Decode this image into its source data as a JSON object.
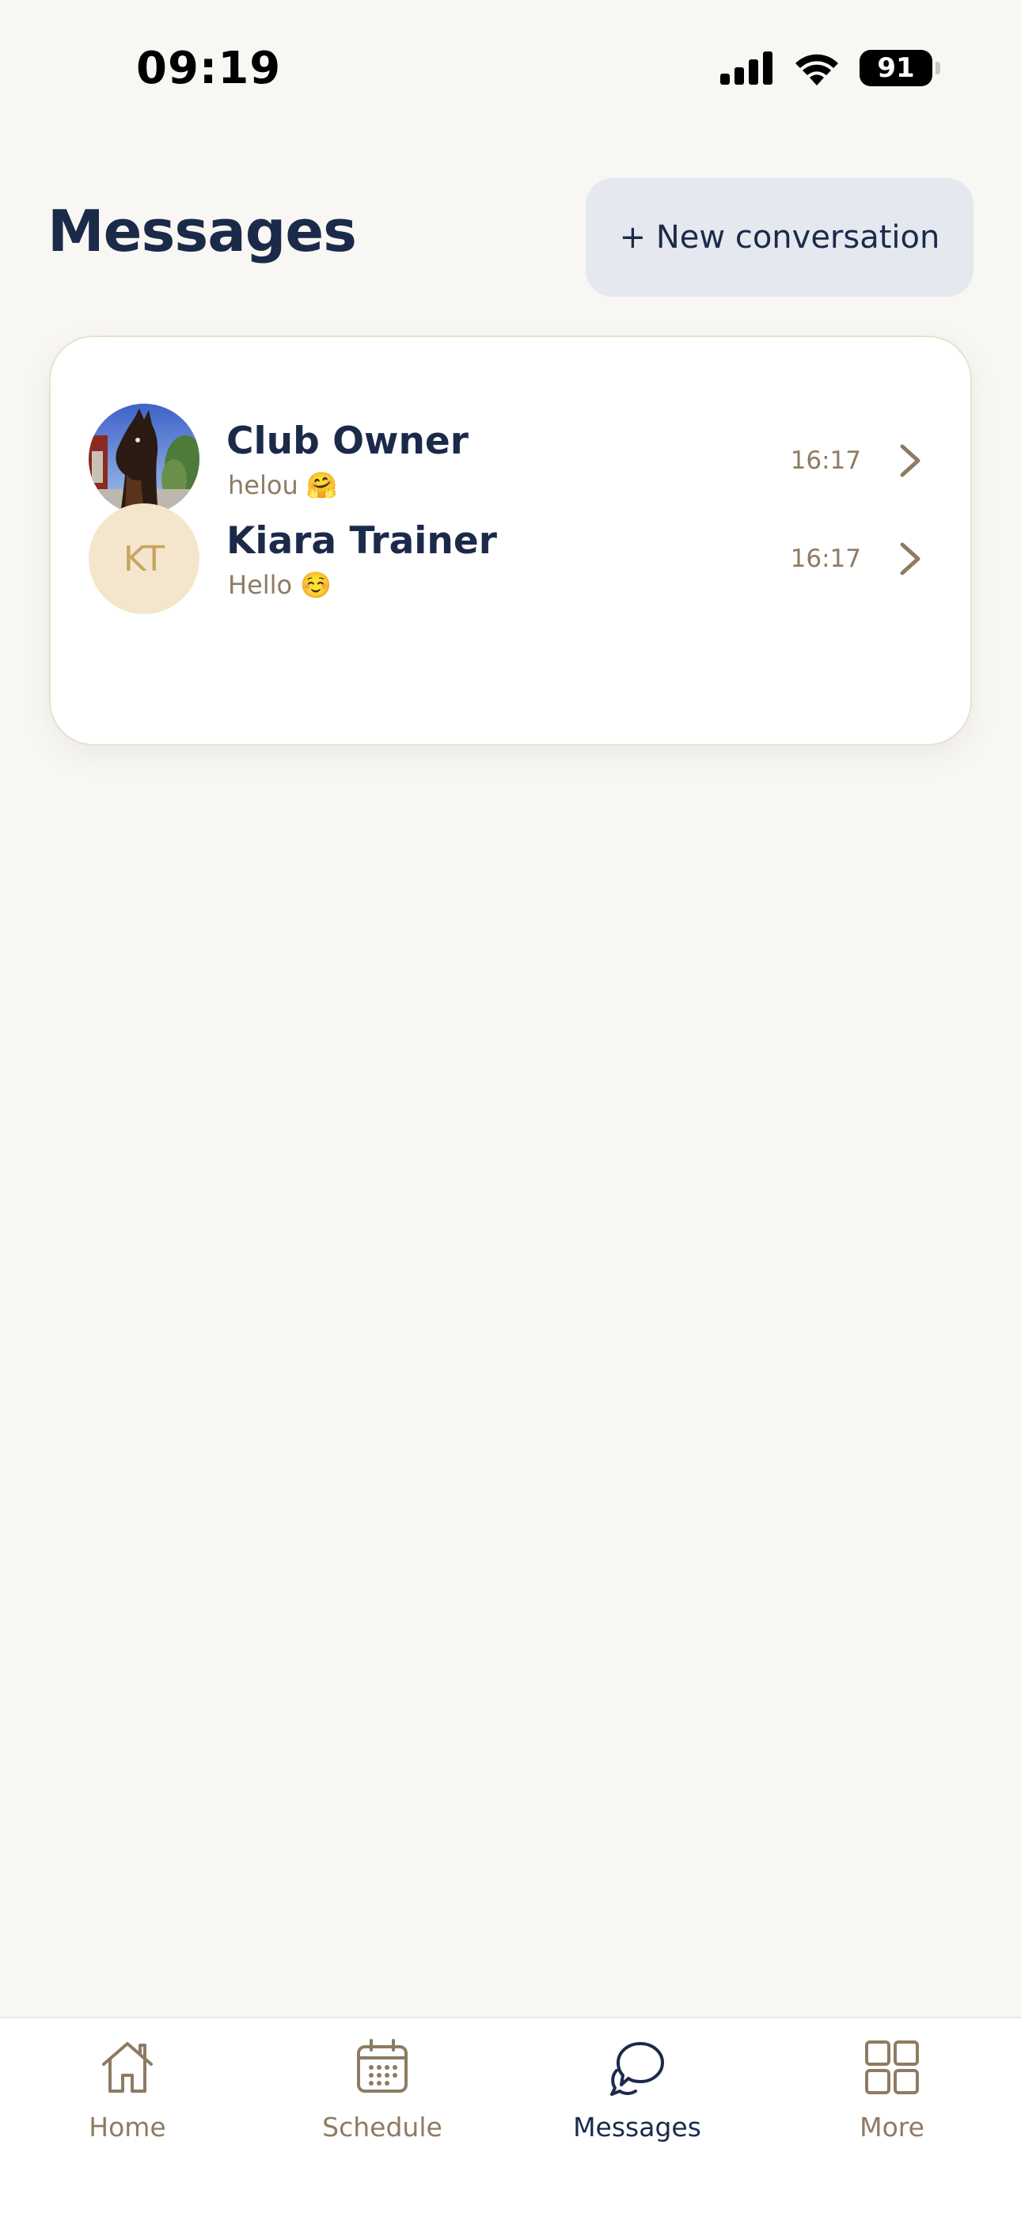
{
  "status_bar": {
    "time": "09:19",
    "battery": "91"
  },
  "header": {
    "title": "Messages",
    "new_conversation_label": "+ New conversation"
  },
  "conversations": [
    {
      "name": "Club Owner",
      "preview": "helou 🤗",
      "time": "16:17",
      "avatar": "photo-of-horse"
    },
    {
      "name": "Kiara Trainer",
      "preview": "Hello ☺️",
      "time": "16:17",
      "initials": "KT"
    }
  ],
  "tab_bar": {
    "items": [
      {
        "label": "Home",
        "icon": "home-icon"
      },
      {
        "label": "Schedule",
        "icon": "calendar-icon"
      },
      {
        "label": "Messages",
        "icon": "chat-bubble-icon",
        "active": true
      },
      {
        "label": "More",
        "icon": "grid-icon"
      }
    ]
  },
  "colors": {
    "background": "#f8f7f3",
    "navy": "#1c2a4a",
    "muted_brown": "#8e7b63",
    "button_bg": "#e5e8ef",
    "initials_bg": "#f3e6cd",
    "initials_text": "#c8a45f"
  }
}
